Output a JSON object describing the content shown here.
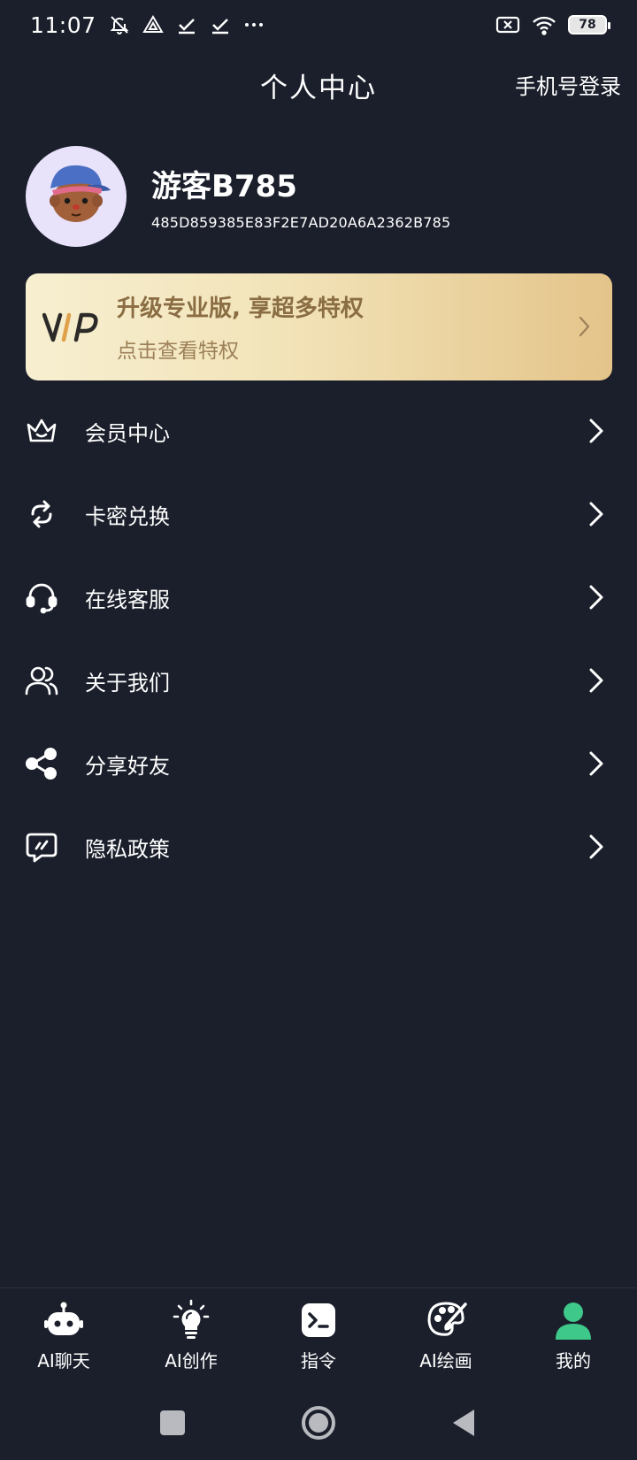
{
  "status_bar": {
    "time": "11:07",
    "battery": "78",
    "icons": [
      "bell-off-icon",
      "triangle-app-icon",
      "check-icon",
      "check-icon",
      "more-dots-icon",
      "sim-x-icon",
      "wifi-icon",
      "battery-icon"
    ]
  },
  "header": {
    "title": "个人中心",
    "login_link": "手机号登录"
  },
  "profile": {
    "name": "游客B785",
    "id": "485D859385E83F2E7AD20A6A2362B785"
  },
  "vip_card": {
    "logo_text": "VIP",
    "title": "升级专业版, 享超多特权",
    "subtitle": "点击查看特权"
  },
  "menu": {
    "items": [
      {
        "label": "会员中心",
        "icon": "crown-icon"
      },
      {
        "label": "卡密兑换",
        "icon": "exchange-icon"
      },
      {
        "label": "在线客服",
        "icon": "headset-icon"
      },
      {
        "label": "关于我们",
        "icon": "users-icon"
      },
      {
        "label": "分享好友",
        "icon": "share-icon"
      },
      {
        "label": "隐私政策",
        "icon": "privacy-icon"
      }
    ]
  },
  "tabbar": {
    "tabs": [
      {
        "label": "AI聊天",
        "icon": "robot-icon"
      },
      {
        "label": "AI创作",
        "icon": "lightbulb-icon"
      },
      {
        "label": "指令",
        "icon": "terminal-icon"
      },
      {
        "label": "AI绘画",
        "icon": "palette-icon"
      },
      {
        "label": "我的",
        "icon": "person-icon",
        "active": true
      }
    ],
    "active_color": "#3ec98b"
  },
  "colors": {
    "background": "#1b1f2b",
    "vip_text": "#8a6d43"
  }
}
